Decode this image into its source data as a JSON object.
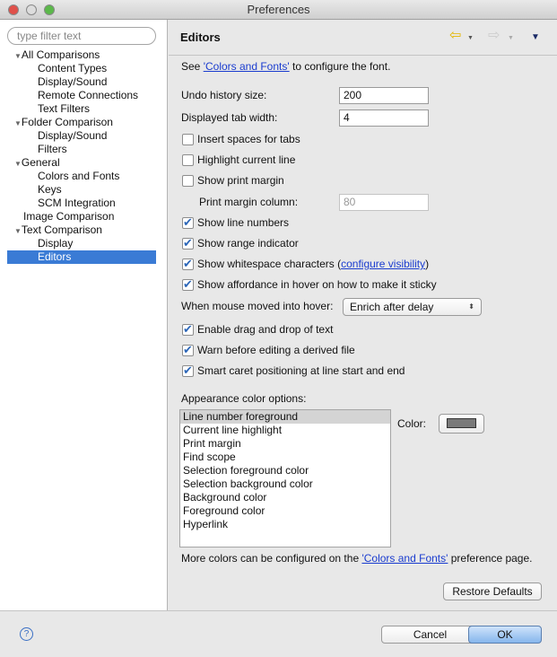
{
  "window": {
    "title": "Preferences"
  },
  "sidebar": {
    "filter_placeholder": "type filter text",
    "items": [
      {
        "label": "All Comparisons",
        "level": 0,
        "expanded": true
      },
      {
        "label": "Content Types",
        "level": 1
      },
      {
        "label": "Display/Sound",
        "level": 1
      },
      {
        "label": "Remote Connections",
        "level": 1
      },
      {
        "label": "Text Filters",
        "level": 1
      },
      {
        "label": "Folder Comparison",
        "level": 0,
        "expanded": true
      },
      {
        "label": "Display/Sound",
        "level": 1
      },
      {
        "label": "Filters",
        "level": 1
      },
      {
        "label": "General",
        "level": 0,
        "expanded": true
      },
      {
        "label": "Colors and Fonts",
        "level": 1
      },
      {
        "label": "Keys",
        "level": 1
      },
      {
        "label": "SCM Integration",
        "level": 1
      },
      {
        "label": "Image Comparison",
        "level": 0
      },
      {
        "label": "Text Comparison",
        "level": 0,
        "expanded": true
      },
      {
        "label": "Display",
        "level": 1
      },
      {
        "label": "Editors",
        "level": 1,
        "selected": true
      }
    ]
  },
  "header": {
    "title": "Editors",
    "icons": [
      "back-arrow-icon",
      "forward-arrow-icon",
      "view-menu-icon"
    ]
  },
  "main": {
    "see_prefix": "See ",
    "see_link": "'Colors and Fonts'",
    "see_suffix": " to configure the font.",
    "undo_label": "Undo history size:",
    "undo_value": "200",
    "tab_label": "Displayed tab width:",
    "tab_value": "4",
    "cb_spaces": "Insert spaces for tabs",
    "cb_highlight": "Highlight current line",
    "cb_margin": "Show print margin",
    "margin_col_label": "Print margin column:",
    "margin_col_value": "80",
    "cb_line_numbers": "Show line numbers",
    "cb_range": "Show range indicator",
    "cb_whitespace": "Show whitespace characters",
    "whitespace_link": "configure visibility",
    "cb_affordance": "Show affordance in hover on how to make it sticky",
    "hover_label": "When mouse moved into hover:",
    "hover_value": "Enrich after delay",
    "cb_dnd": "Enable drag and drop of text",
    "cb_warn": "Warn before editing a derived file",
    "cb_caret": "Smart caret positioning at line start and end",
    "appearance_label": "Appearance color options:",
    "appearance_items": [
      "Line number foreground",
      "Current line highlight",
      "Print margin",
      "Find scope",
      "Selection foreground color",
      "Selection background color",
      "Background color",
      "Foreground color",
      "Hyperlink"
    ],
    "color_label": "Color:",
    "color_value": "#7a7a7a",
    "more_prefix": "More colors can be configured on the ",
    "more_link": "'Colors and Fonts'",
    "more_suffix": " preference page.",
    "restore_defaults": "Restore Defaults"
  },
  "footer": {
    "cancel": "Cancel",
    "ok": "OK"
  }
}
